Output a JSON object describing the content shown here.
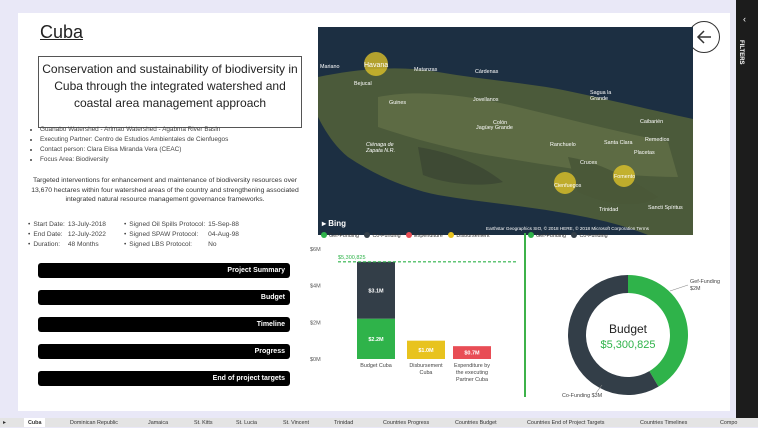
{
  "header": {
    "title": "Cuba"
  },
  "project": {
    "title": "Conservation and sustainability of biodiversity in Cuba through the integrated watershed and coastal area management approach",
    "bullets": [
      "Guanabo Watershed - Arimao Watershed - Agabma River Basin",
      "Executing Partner: Centro de Estudios Ambientales de Cienfuegos",
      "Contact person: Clara Elisa Miranda Vera (CEAC)",
      "Focus Area: Biodiversity"
    ],
    "description": "Targeted interventions for enhancement and maintenance of biodiversity resources over 13,670 hectares within four watershed areas of the country and strengthening associated integrated natural resource management governance frameworks.",
    "dates": {
      "start_label": "Start Date:",
      "start_value": "13-July-2018",
      "end_label": "End Date:",
      "end_value": "12-July-2022",
      "duration_label": "Duration:",
      "duration_value": "48 Months",
      "oil_label": "Signed Oil Spills Protocol:",
      "oil_value": "15-Sep-88",
      "spaw_label": "Signed SPAW Protocol:",
      "spaw_value": "04-Aug-98",
      "lbs_label": "Signed LBS Protocol:",
      "lbs_value": "No"
    }
  },
  "nav_buttons": [
    "Project Summary",
    "Budget",
    "Timeline",
    "Progress",
    "End of project targets"
  ],
  "map": {
    "labels": [
      "Mariano",
      "Havana",
      "Matanzas",
      "Cárdenas",
      "Bejucal",
      "Guines",
      "Jovellanos",
      "Colón",
      "Sagua la Grande",
      "Caibarién",
      "Remedios",
      "Placetas",
      "Santa Clara",
      "Ranchuelo",
      "Cruces",
      "Jagüey Grande",
      "Cienfuegos",
      "Fomento",
      "Trinidad",
      "Sancti Spíritus",
      "Ciénaga de Zapata N.R."
    ],
    "logo": "Bing",
    "attribution": "Earthstar Geographics SIO, © 2018 HERE, © 2018 Microsoft Corporation Terms"
  },
  "bar_legend": [
    {
      "label": "Gef-Funding",
      "color": "#2fb34a"
    },
    {
      "label": "Co-Funding",
      "color": "#333e48"
    },
    {
      "label": "Expenditure",
      "color": "#e84d55"
    },
    {
      "label": "Disbursement",
      "color": "#e8c31e"
    }
  ],
  "donut_legend": [
    {
      "label": "Gef-Funding",
      "color": "#2fb34a"
    },
    {
      "label": "Co-Funding",
      "color": "#333e48"
    }
  ],
  "chart_data": [
    {
      "type": "bar",
      "categories": [
        "Budget Cuba",
        "Disbursement Cuba",
        "Expenditure by the executing Partner Cuba"
      ],
      "series": [
        {
          "name": "Gef-Funding",
          "values": [
            2.2,
            0,
            0
          ]
        },
        {
          "name": "Co-Funding",
          "values": [
            3.1,
            0,
            0
          ]
        },
        {
          "name": "Disbursement",
          "values": [
            0,
            1.0,
            0
          ]
        },
        {
          "name": "Expenditure",
          "values": [
            0,
            0,
            0.7
          ]
        }
      ],
      "data_labels": [
        "$2.2M",
        "$3.1M",
        "$1.0M",
        "$0.7M"
      ],
      "yticks": [
        "$0M",
        "$2M",
        "$4M",
        "$6M"
      ],
      "ylim": [
        0,
        6
      ],
      "reference_value": 5.300825,
      "reference_label": "$5,300,825"
    },
    {
      "type": "pie",
      "labels": [
        "Gef-Funding",
        "Co-Funding"
      ],
      "values": [
        2.2,
        3.1
      ],
      "slice_labels": [
        "Gef-Funding $2M",
        "Co-Funding $3M"
      ],
      "center_title": "Budget",
      "center_value": "$5,300,825"
    }
  ],
  "tabs": [
    "Cuba",
    "Dominican Republic",
    "Jamaica",
    "St. Kitts",
    "St. Lucia",
    "St. Vincent",
    "Trinidad",
    "Countries Progress",
    "Countries Budget",
    "Countries End of Project Targets",
    "Countries Timelines",
    "Compo"
  ],
  "side_panel": {
    "filters_label": "FILTERS",
    "collapse_icon": "‹"
  }
}
